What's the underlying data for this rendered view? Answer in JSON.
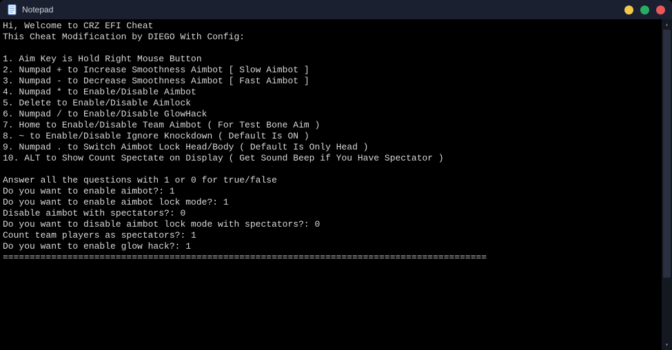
{
  "titlebar": {
    "app_name": "Notepad"
  },
  "content": {
    "lines": [
      "Hi, Welcome to CRZ EFI Cheat",
      "This Cheat Modification by DIEGO With Config:",
      "",
      "1. Aim Key is Hold Right Mouse Button",
      "2. Numpad + to Increase Smoothness Aimbot [ Slow Aimbot ]",
      "3. Numpad - to Decrease Smoothness Aimbot [ Fast Aimbot ]",
      "4. Numpad * to Enable/Disable Aimbot",
      "5. Delete to Enable/Disable Aimlock",
      "6. Numpad / to Enable/Disable GlowHack",
      "7. Home to Enable/Disable Team Aimbot ( For Test Bone Aim )",
      "8. ~ to Enable/Disable Ignore Knockdown ( Default Is ON )",
      "9. Numpad . to Switch Aimbot Lock Head/Body ( Default Is Only Head )",
      "10. ALT to Show Count Spectate on Display ( Get Sound Beep if You Have Spectator )",
      "",
      "Answer all the questions with 1 or 0 for true/false",
      "Do you want to enable aimbot?: 1",
      "Do you want to enable aimbot lock mode?: 1",
      "Disable aimbot with spectators?: 0",
      "Do you want to disable aimbot lock mode with spectators?: 0",
      "Count team players as spectators?: 1",
      "Do you want to enable glow hack?: 1",
      "=========================================================================================="
    ]
  }
}
